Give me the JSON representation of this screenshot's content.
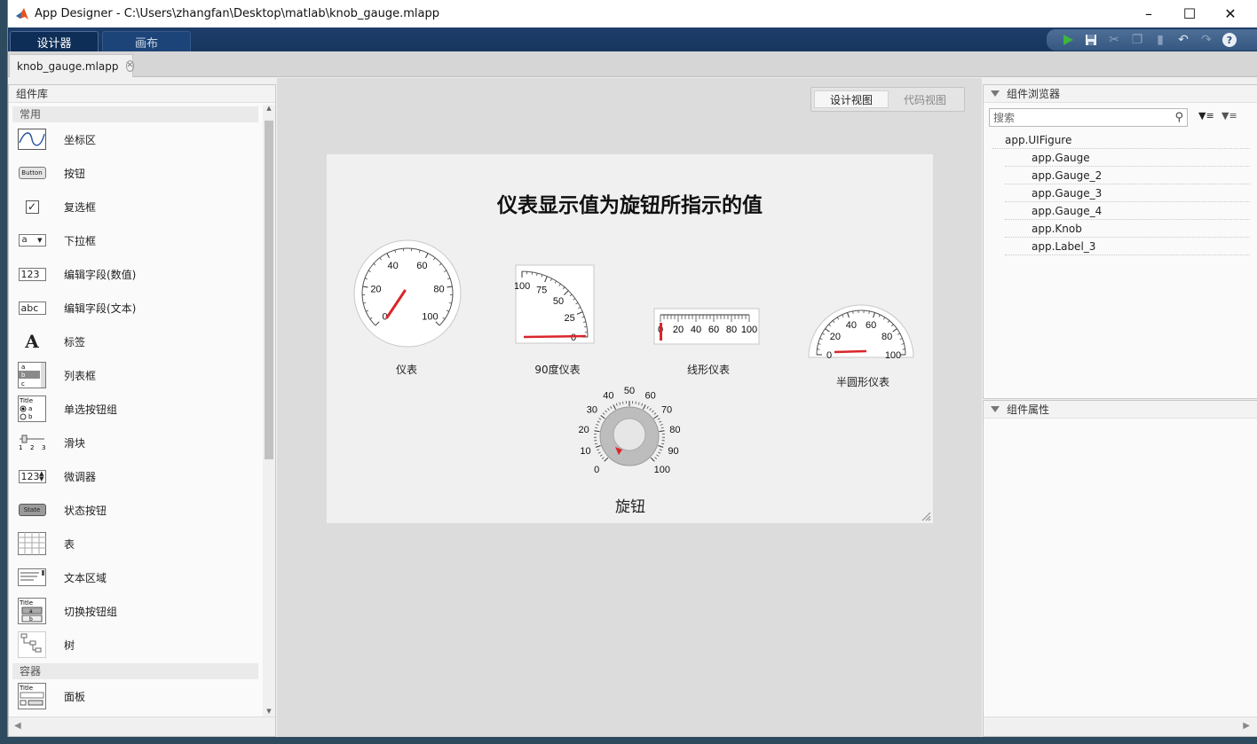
{
  "window": {
    "title": "App Designer - C:\\Users\\zhangfan\\Desktop\\matlab\\knob_gauge.mlapp"
  },
  "ribbon": {
    "tabs": [
      "设计器",
      "画布"
    ]
  },
  "quick_access": [
    "run-icon",
    "save-icon",
    "cut-icon",
    "copy-icon",
    "paste-icon",
    "undo-icon",
    "redo-icon",
    "help-icon"
  ],
  "doc_tab": {
    "label": "knob_gauge.mlapp"
  },
  "library": {
    "title": "组件库",
    "cat_common": "常用",
    "items": [
      "坐标区",
      "按钮",
      "复选框",
      "下拉框",
      "编辑字段(数值)",
      "编辑字段(文本)",
      "标签",
      "列表框",
      "单选按钮组",
      "滑块",
      "微调器",
      "状态按钮",
      "表",
      "文本区域",
      "切换按钮组",
      "树"
    ],
    "cat_container": "容器",
    "container_items": [
      "面板"
    ],
    "thumb_text": {
      "button": "Button",
      "dropdown": "a",
      "numeric": "123",
      "text": "abc",
      "label": "A",
      "state": "State",
      "spinner": "123",
      "title": "Title",
      "slider": "1 2 3"
    }
  },
  "view_toggle": {
    "design": "设计视图",
    "code": "代码视图"
  },
  "figure": {
    "title": "仪表显示值为旋钮所指示的值",
    "gauge": {
      "label": "仪表",
      "ticks": [
        "0",
        "20",
        "40",
        "60",
        "80",
        "100"
      ],
      "value": 0
    },
    "gauge90": {
      "label": "90度仪表",
      "ticks": [
        "0",
        "25",
        "50",
        "75",
        "100"
      ],
      "value": 0
    },
    "linear": {
      "label": "线形仪表",
      "ticks": [
        "0",
        "20",
        "40",
        "60",
        "80",
        "100"
      ],
      "value": 0
    },
    "semi": {
      "label": "半圆形仪表",
      "ticks": [
        "0",
        "20",
        "40",
        "60",
        "80",
        "100"
      ],
      "value": 0
    },
    "knob": {
      "label": "旋钮",
      "ticks": [
        "0",
        "10",
        "20",
        "30",
        "40",
        "50",
        "60",
        "70",
        "80",
        "90",
        "100"
      ],
      "value": 0
    }
  },
  "browser": {
    "title": "组件浏览器",
    "search_placeholder": "搜索",
    "nodes": [
      "app.UIFigure",
      "app.Gauge",
      "app.Gauge_2",
      "app.Gauge_3",
      "app.Gauge_4",
      "app.Knob",
      "app.Label_3"
    ]
  },
  "properties": {
    "title": "组件属性"
  },
  "colors": {
    "ribbon": "#16365e",
    "needle": "#d9262b"
  }
}
